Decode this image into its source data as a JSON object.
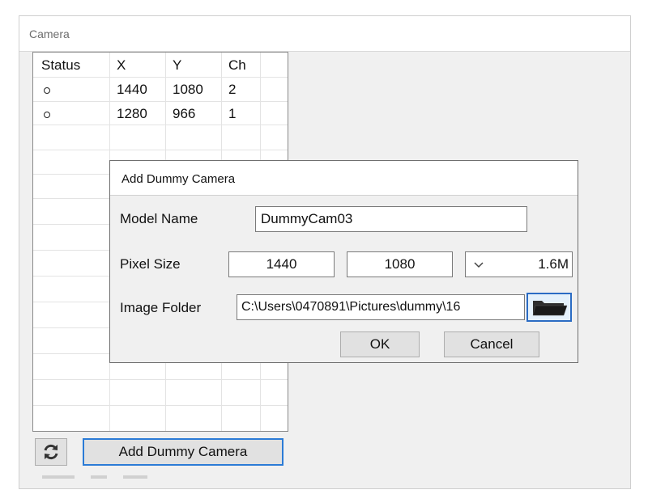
{
  "window": {
    "title": "Camera"
  },
  "table": {
    "columns": [
      "Status",
      "X",
      "Y",
      "Ch"
    ],
    "rows": [
      {
        "status": "o",
        "x": "1440",
        "y": "1080",
        "ch": "2"
      },
      {
        "status": "o",
        "x": "1280",
        "y": "966",
        "ch": "1"
      }
    ]
  },
  "toolbar": {
    "refresh_icon": "refresh-icon",
    "add_label": "Add Dummy Camera"
  },
  "dialog": {
    "title": "Add Dummy Camera",
    "model_name_label": "Model Name",
    "model_name_value": "DummyCam03",
    "pixel_size_label": "Pixel Size",
    "pixel_x": "1440",
    "pixel_y": "1080",
    "pixel_preset": "1.6M",
    "dropdown_icon": "chevron-down-icon",
    "image_folder_label": "Image Folder",
    "image_folder_value": "C:\\Users\\0470891\\Pictures\\dummy\\16",
    "folder_icon": "folder-icon",
    "ok_label": "OK",
    "cancel_label": "Cancel"
  },
  "colors": {
    "accent": "#2b7bd6",
    "window_bg": "#f0f0f0",
    "field_border": "#7a7a7a"
  }
}
